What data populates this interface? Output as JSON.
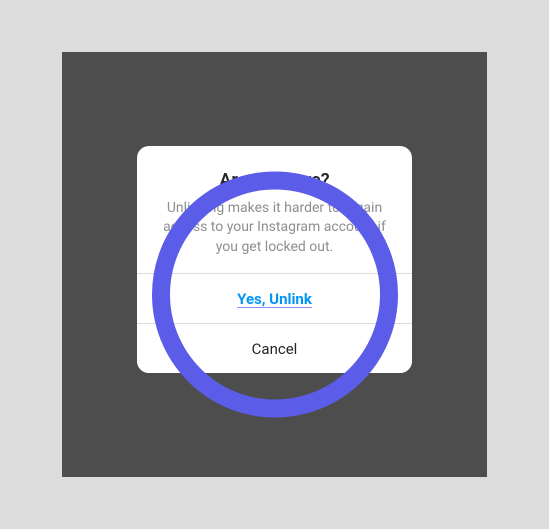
{
  "dialog": {
    "title": "Are you sure?",
    "message": "Unlinking makes it harder to regain access to your Instagram account if you get locked out.",
    "confirm_label": "Yes, Unlink",
    "cancel_label": "Cancel"
  }
}
